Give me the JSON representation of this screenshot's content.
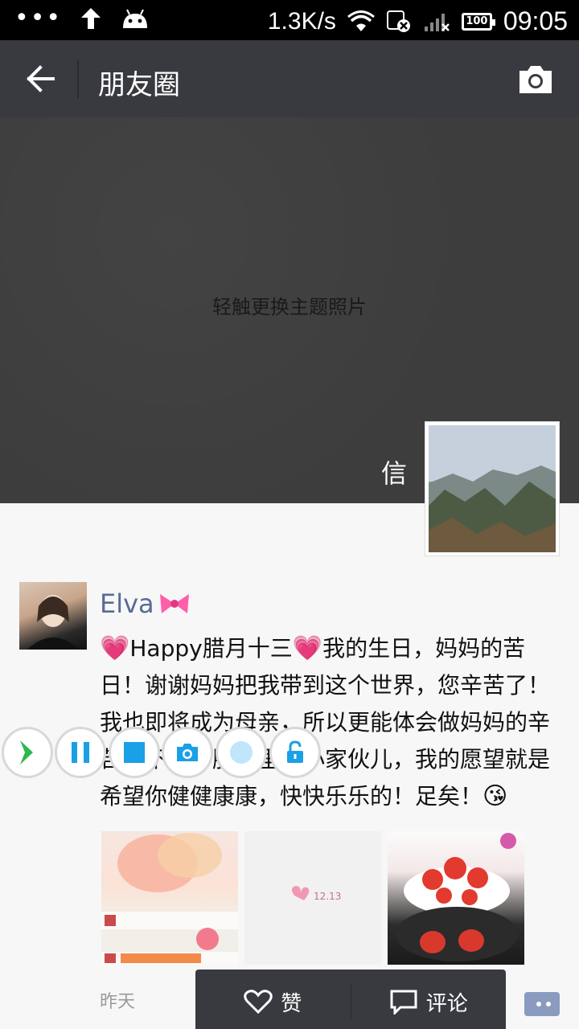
{
  "status_bar": {
    "speed": "1.3K/s",
    "battery": "100",
    "time": "09:05"
  },
  "header": {
    "title": "朋友圈"
  },
  "cover": {
    "hint": "轻触更换主题照片",
    "name": "信"
  },
  "post": {
    "author": "Elva",
    "text_lines": [
      "Happy腊月十三",
      "我的生日，妈妈的苦日！谢谢妈妈把我带到这个世界，您辛苦了！我也即将成为母亲，所以更能体会做妈妈的辛苦和不易，肚肚里的小家伙儿，我的愿望就是希望你健健康康，快快乐乐的！足矣！"
    ],
    "time": "昨天",
    "thumb2_caption": "12.13"
  },
  "popup": {
    "like_label": "赞",
    "comment_label": "评论"
  },
  "colors": {
    "titlebar": "#393a3f",
    "name_link": "#576b95",
    "accent_blue": "#1aa0e6",
    "record_green": "#2db84b"
  }
}
